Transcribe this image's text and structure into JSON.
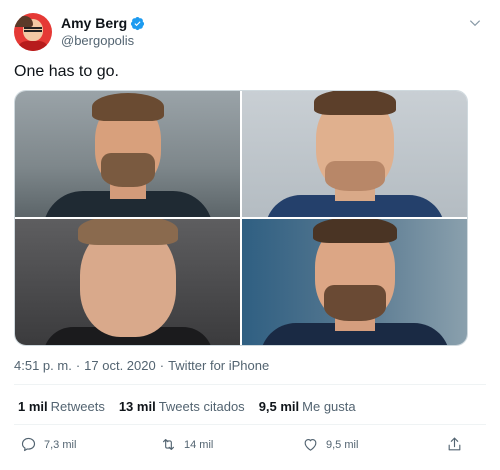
{
  "author": {
    "display_name": "Amy Berg",
    "handle": "@bergopolis",
    "verified": true
  },
  "tweet": {
    "text": "One has to go."
  },
  "meta": {
    "time": "4:51 p. m.",
    "separator": "·",
    "date": "17 oct. 2020",
    "source": "Twitter for iPhone"
  },
  "stats": [
    {
      "count": "1 mil",
      "label": "Retweets"
    },
    {
      "count": "13 mil",
      "label": "Tweets citados"
    },
    {
      "count": "9,5 mil",
      "label": "Me gusta"
    }
  ],
  "actions": {
    "reply_count": "7,3 mil",
    "retweet_count": "14 mil",
    "like_count": "9,5 mil"
  },
  "icons": {
    "verified": "verified-badge-icon",
    "more": "chevron-down-icon",
    "reply": "reply-icon",
    "retweet": "retweet-icon",
    "like": "heart-icon",
    "share": "share-icon"
  },
  "colors": {
    "accent": "#1d9bf0",
    "text": "#0f1419",
    "muted": "#536471"
  }
}
